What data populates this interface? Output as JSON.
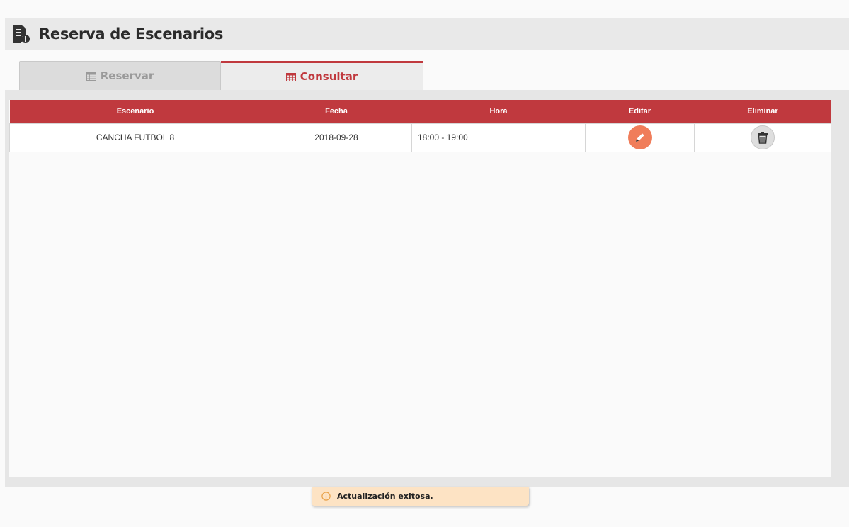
{
  "header": {
    "title": "Reserva de Escenarios",
    "icon": "document-info-icon"
  },
  "tabs": [
    {
      "label": "Reservar",
      "icon": "calendar-icon",
      "active": false
    },
    {
      "label": "Consultar",
      "icon": "calendar-icon",
      "active": true
    }
  ],
  "table": {
    "columns": [
      "Escenario",
      "Fecha",
      "Hora",
      "Editar",
      "Eliminar"
    ],
    "rows": [
      {
        "escenario": "CANCHA FUTBOL 8",
        "fecha": "2018-09-28",
        "hora": "18:00 - 19:00",
        "edit_icon": "pencil-icon",
        "delete_icon": "trash-icon"
      }
    ]
  },
  "toast": {
    "message": "Actualización exitosa.",
    "icon": "info-icon"
  },
  "colors": {
    "accent": "#c0393e",
    "header_bg": "#e9e9e9",
    "edit": "#f07d5a",
    "toast_bg": "#fde3c4"
  }
}
